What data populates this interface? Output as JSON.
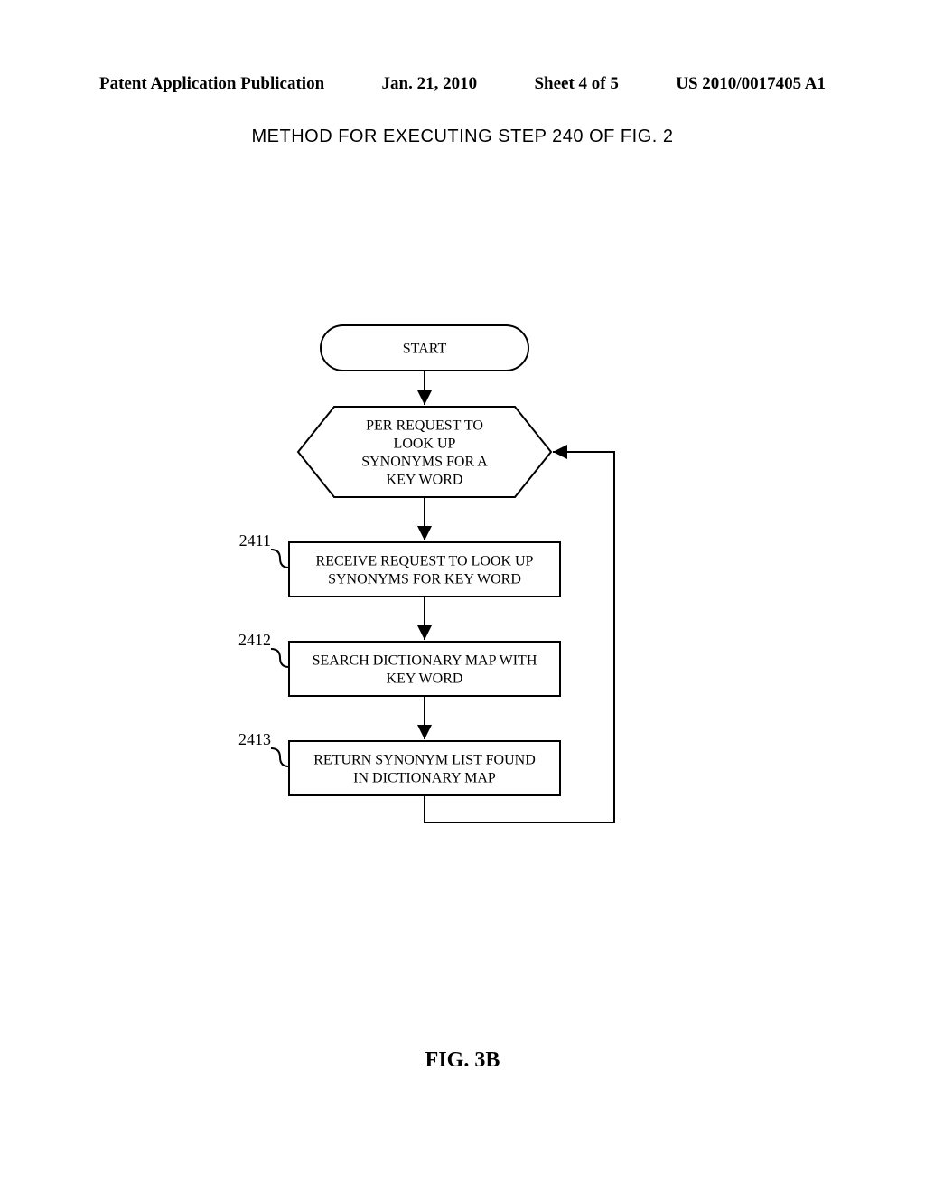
{
  "header": {
    "left": "Patent Application Publication",
    "center_date": "Jan. 21, 2010",
    "center_sheet": "Sheet 4 of 5",
    "right": "US 2010/0017405 A1"
  },
  "title": "METHOD FOR EXECUTING STEP 240 OF FIG. 2",
  "figure_label": "FIG. 3B",
  "flowchart": {
    "start": "START",
    "decision_l1": "PER REQUEST TO",
    "decision_l2": "LOOK UP",
    "decision_l3": "SYNONYMS FOR A",
    "decision_l4": "KEY WORD",
    "step1_ref": "2411",
    "step1_l1": "RECEIVE REQUEST TO LOOK UP",
    "step1_l2": "SYNONYMS FOR KEY WORD",
    "step2_ref": "2412",
    "step2_l1": "SEARCH DICTIONARY MAP WITH",
    "step2_l2": "KEY WORD",
    "step3_ref": "2413",
    "step3_l1": "RETURN SYNONYM LIST FOUND",
    "step3_l2": "IN DICTIONARY MAP"
  }
}
